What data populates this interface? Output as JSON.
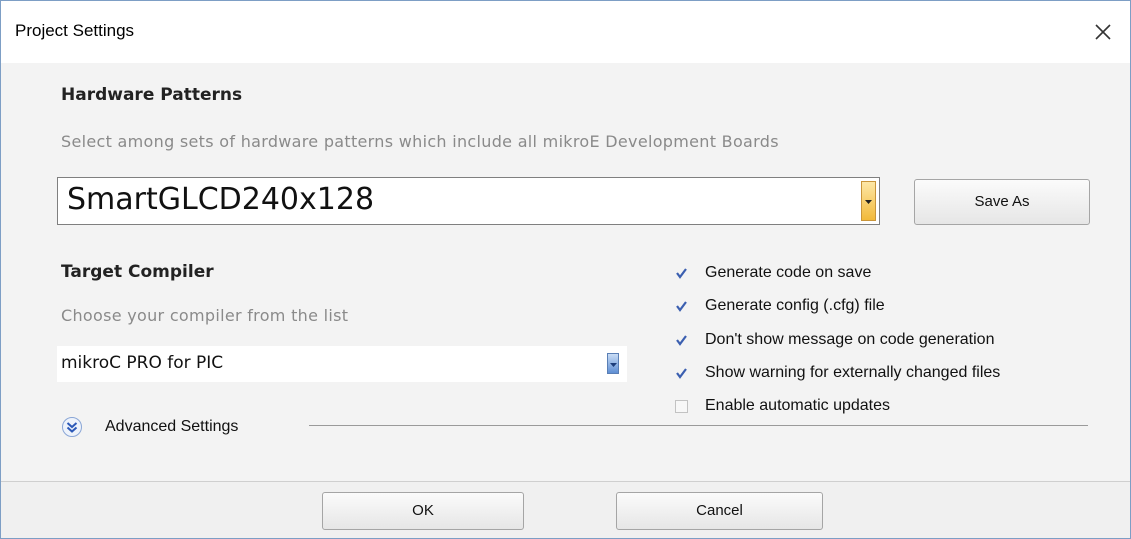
{
  "window": {
    "title": "Project Settings",
    "close_icon": "close-icon"
  },
  "hardware_patterns": {
    "heading": "Hardware Patterns",
    "hint": "Select among sets of hardware patterns which include all mikroE Development Boards",
    "selected": "SmartGLCD240x128",
    "save_as_label": "Save As"
  },
  "target_compiler": {
    "heading": "Target Compiler",
    "hint": "Choose your compiler from the list",
    "selected": "mikroC PRO for PIC"
  },
  "options": [
    {
      "label": "Generate code on save",
      "checked": true
    },
    {
      "label": "Generate config (.cfg) file",
      "checked": true
    },
    {
      "label": "Don't show message on code generation",
      "checked": true
    },
    {
      "label": "Show warning for externally changed files",
      "checked": true
    },
    {
      "label": "Enable automatic updates",
      "checked": false
    }
  ],
  "advanced": {
    "label": "Advanced Settings",
    "icon": "chevron-double-down-icon"
  },
  "footer": {
    "ok_label": "OK",
    "cancel_label": "Cancel"
  },
  "colors": {
    "check_mark": "#3b5fb0",
    "border": "#7d9ec5",
    "combo_arrow": "#f2b93a"
  }
}
